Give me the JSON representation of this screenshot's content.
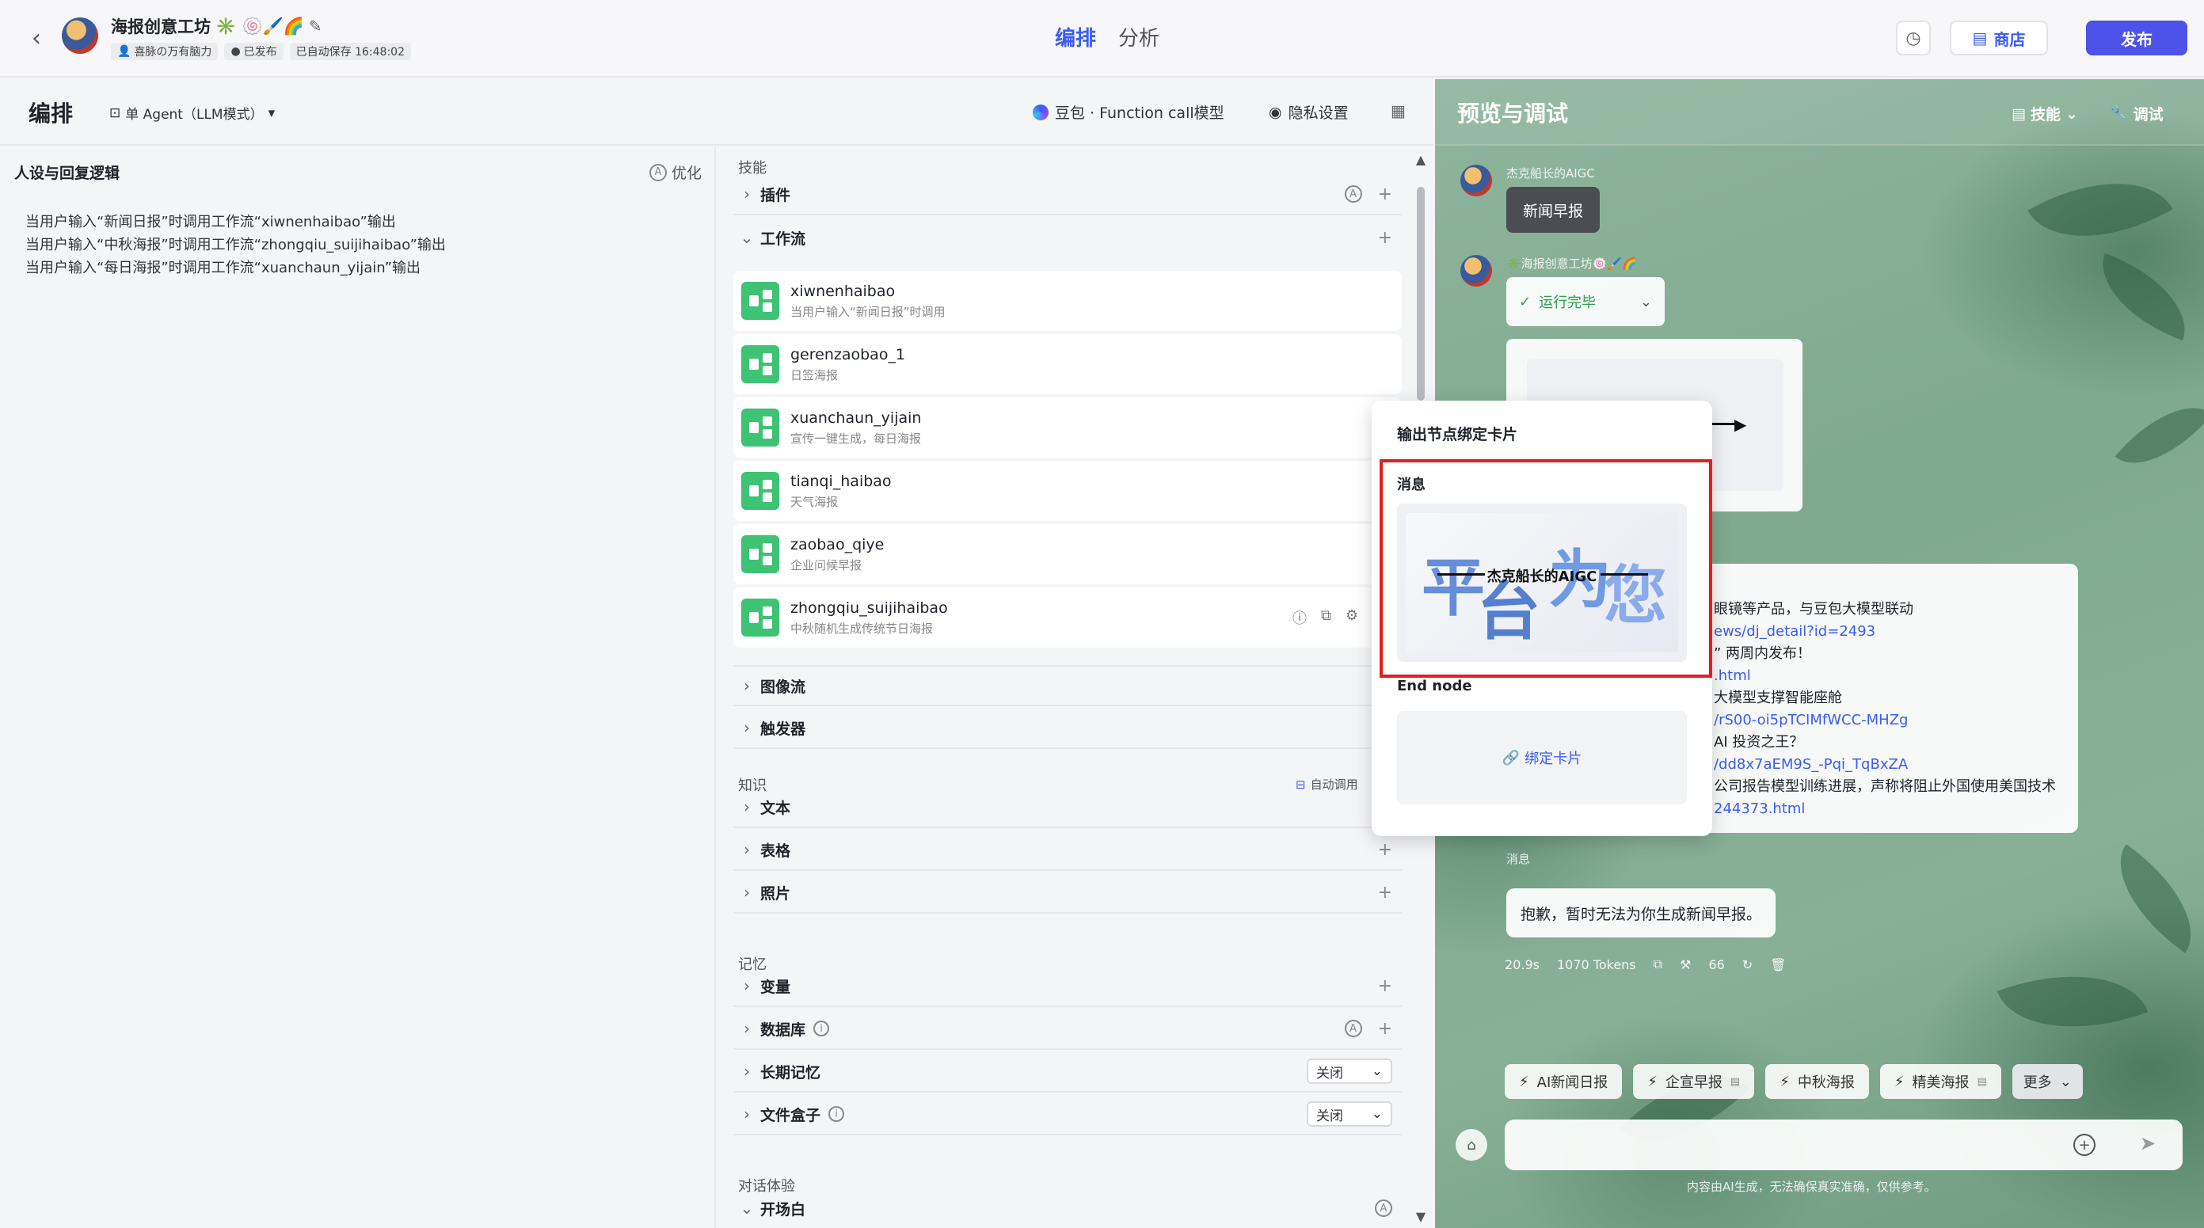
{
  "app": {
    "bot_name": "海报创意工坊",
    "bot_name_emojis": "✳️ 🍥🖌️🌈",
    "creator": "喜脉の万有脑力",
    "publish_status": "已发布",
    "autosave": "已自动保存 16:48:02",
    "tabs": [
      "编排",
      "分析"
    ],
    "store_label": "商店",
    "publish_label": "发布"
  },
  "arrange": {
    "title": "编排",
    "agent_mode": "单 Agent（LLM模式）",
    "model": "豆包 · Function call模型",
    "privacy": "隐私设置"
  },
  "persona": {
    "title": "人设与回复逻辑",
    "optimize": "优化",
    "lines": [
      "当用户输入“新闻日报”时调用工作流“xiwnenhaibao”输出",
      "当用户输入“中秋海报”时调用工作流“zhongqiu_suijihaibao”输出",
      "当用户输入“每日海报”时调用工作流“xuanchaun_yijain”输出"
    ]
  },
  "skills": {
    "section": "技能",
    "plugin": "插件",
    "workflow": "工作流",
    "workflows": [
      {
        "name": "xiwnenhaibao",
        "desc": "当用户输入“新闻日报”时调用"
      },
      {
        "name": "gerenzaobao_1",
        "desc": "日签海报"
      },
      {
        "name": "xuanchaun_yijain",
        "desc": "宣传一键生成，每日海报"
      },
      {
        "name": "tianqi_haibao",
        "desc": "天气海报"
      },
      {
        "name": "zaobao_qiye",
        "desc": "企业问候早报"
      },
      {
        "name": "zhongqiu_suijihaibao",
        "desc": "中秋随机生成传统节日海报"
      }
    ],
    "image_flow": "图像流",
    "trigger": "触发器",
    "knowledge_section": "知识",
    "auto_call": "自动调用",
    "text": "文本",
    "table": "表格",
    "photo": "照片",
    "memory_section": "记忆",
    "variable": "变量",
    "database": "数据库",
    "long_memory": "长期记忆",
    "long_memory_value": "关闭",
    "file_box": "文件盒子",
    "file_box_value": "关闭",
    "dialog_section": "对话体验",
    "opening": "开场白"
  },
  "popup": {
    "title": "输出节点绑定卡片",
    "message_label": "消息",
    "card_caption": "杰克船长的AIGC",
    "end_node": "End node",
    "bind_card": "绑定卡片"
  },
  "preview": {
    "title": "预览与调试",
    "skill": "技能",
    "debug": "调试",
    "user_name": "杰克船长的AIGC",
    "user_message": "新闻早报",
    "bot_name": "✳️海报创意工坊🍥🖌️🌈",
    "run_status": "运行完毕",
    "news_lines": [
      "眼镜等产品，与豆包大模型联动",
      "ews/dj_detail?id=2493",
      "” 两周内发布！",
      ".html",
      "大模型支撑智能座舱",
      "/rS00-oi5pTCIMfWCC-MHZg",
      "AI 投资之王？",
      "/dd8x7aEM9S_-Pqi_TqBxZA",
      "公司报告模型训练进展，声称将阻止外国使用美国技术",
      "244373.html"
    ],
    "message_label": "消息",
    "reply": "抱歉，暂时无法为你生成新闻早报。",
    "time": "20.9s",
    "tokens": "1070 Tokens",
    "count": "66",
    "quick_actions": [
      "AI新闻日报",
      "企宣早报",
      "中秋海报",
      "精美海报"
    ],
    "more": "更多",
    "disclaimer": "内容由AI生成，无法确保真实准确，仅供参考。"
  },
  "colors": {
    "accent": "#3b5bf6",
    "publish": "#4d53e8",
    "workflow_icon": "#3ec274",
    "highlight_border": "#e02020",
    "success": "#2a9d4f"
  }
}
